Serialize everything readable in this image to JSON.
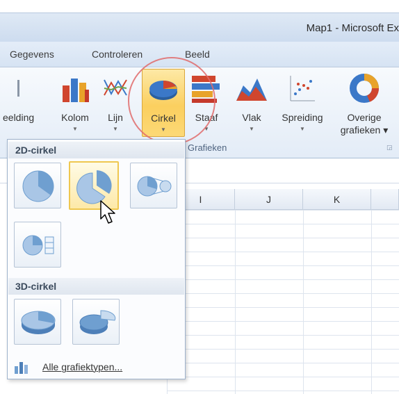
{
  "window": {
    "title": "Map1 - Microsoft Ex"
  },
  "tabs": [
    {
      "label": "Gegevens"
    },
    {
      "label": "Controleren"
    },
    {
      "label": "Beeld"
    }
  ],
  "ribbon": {
    "buttons": [
      {
        "label": "eelding",
        "icon": "picture-icon"
      },
      {
        "label": "Kolom",
        "icon": "column-chart-icon"
      },
      {
        "label": "Lijn",
        "icon": "line-chart-icon"
      },
      {
        "label": "Cirkel",
        "icon": "pie-chart-icon",
        "active": true
      },
      {
        "label": "Staaf",
        "icon": "bar-chart-icon"
      },
      {
        "label": "Vlak",
        "icon": "area-chart-icon"
      },
      {
        "label": "Spreiding",
        "icon": "scatter-chart-icon"
      },
      {
        "label": "Overige",
        "label2": "grafieken",
        "icon": "donut-chart-icon"
      }
    ],
    "group_label": "Grafieken"
  },
  "grid": {
    "columns": [
      "I",
      "J",
      "K"
    ]
  },
  "dropdown": {
    "section_2d": "2D-cirkel",
    "section_3d": "3D-cirkel",
    "all_types": "Alle grafiektypen..."
  },
  "colors": {
    "accent_highlight": "#fbcf5f",
    "annotation_circle": "#e06b6b",
    "pie_blue": "#6f9fd0"
  }
}
